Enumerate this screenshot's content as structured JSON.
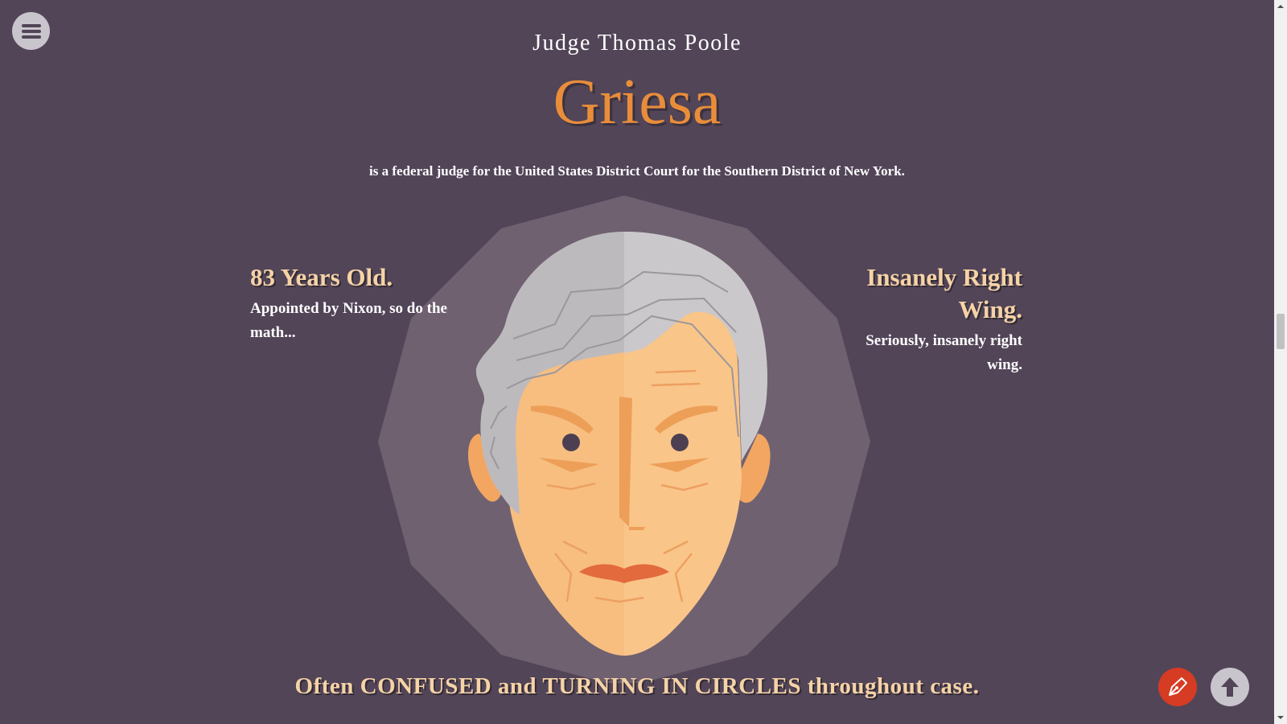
{
  "header": {
    "subtitle": "Judge Thomas Poole",
    "name": "Griesa",
    "description": "is a federal judge for the United States District Court for the Southern District of New York."
  },
  "facts": [
    {
      "heading": "83 Years Old.",
      "body": "Appointed by Nixon, so do the math..."
    },
    {
      "heading": "Insanely Right Wing.",
      "body": "Seriously, insanely right wing."
    }
  ],
  "caption": "Often CONFUSED and TURNING IN CIRCLES throughout case.",
  "icons": {
    "menu": "hamburger-menu-icon",
    "edit": "pen-nib-icon",
    "back_to_top": "arrow-up-icon"
  },
  "colors": {
    "background": "#524558",
    "accent_orange": "#e98d3a",
    "heading_peach": "#f6d3a6",
    "edit_button": "#d63b24",
    "round_button": "#c9c5cc"
  }
}
